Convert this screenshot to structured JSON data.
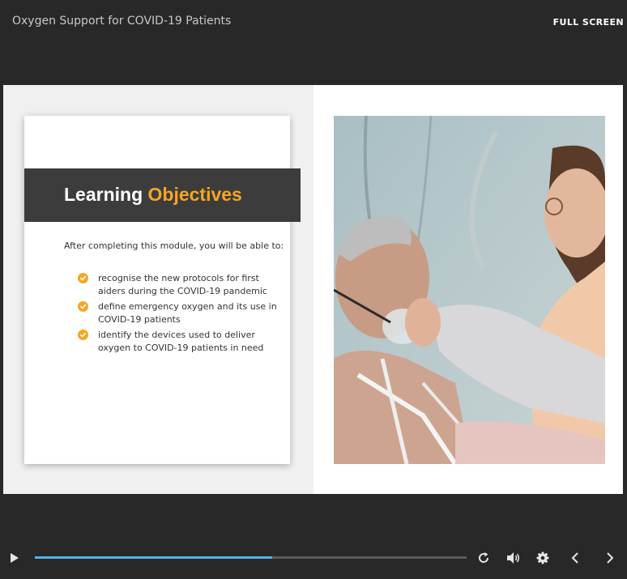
{
  "header": {
    "course_title": "Oxygen Support for COVID-19 Patients",
    "fullscreen_label": "FULL SCREEN"
  },
  "slide": {
    "title_part1": "Learning",
    "title_part2": "Objectives",
    "intro": "After completing this module, you will be able to:",
    "objectives": [
      "recognise the new protocols for first aiders during the COVID-19 pandemic",
      "define emergency oxygen and its use in COVID-19 patients",
      "identify the devices used to deliver oxygen to COVID-19 patients in need"
    ],
    "image_icon": "photo-patient-oxygen-mask"
  },
  "player": {
    "progress": 0.55,
    "icons": [
      "play-icon",
      "replay-icon",
      "volume-icon",
      "settings-icon",
      "prev-icon",
      "next-icon"
    ]
  },
  "colors": {
    "accent": "#f5a623",
    "progress": "#4fb4ee",
    "background": "#282828",
    "banner": "#3c3c3c"
  }
}
